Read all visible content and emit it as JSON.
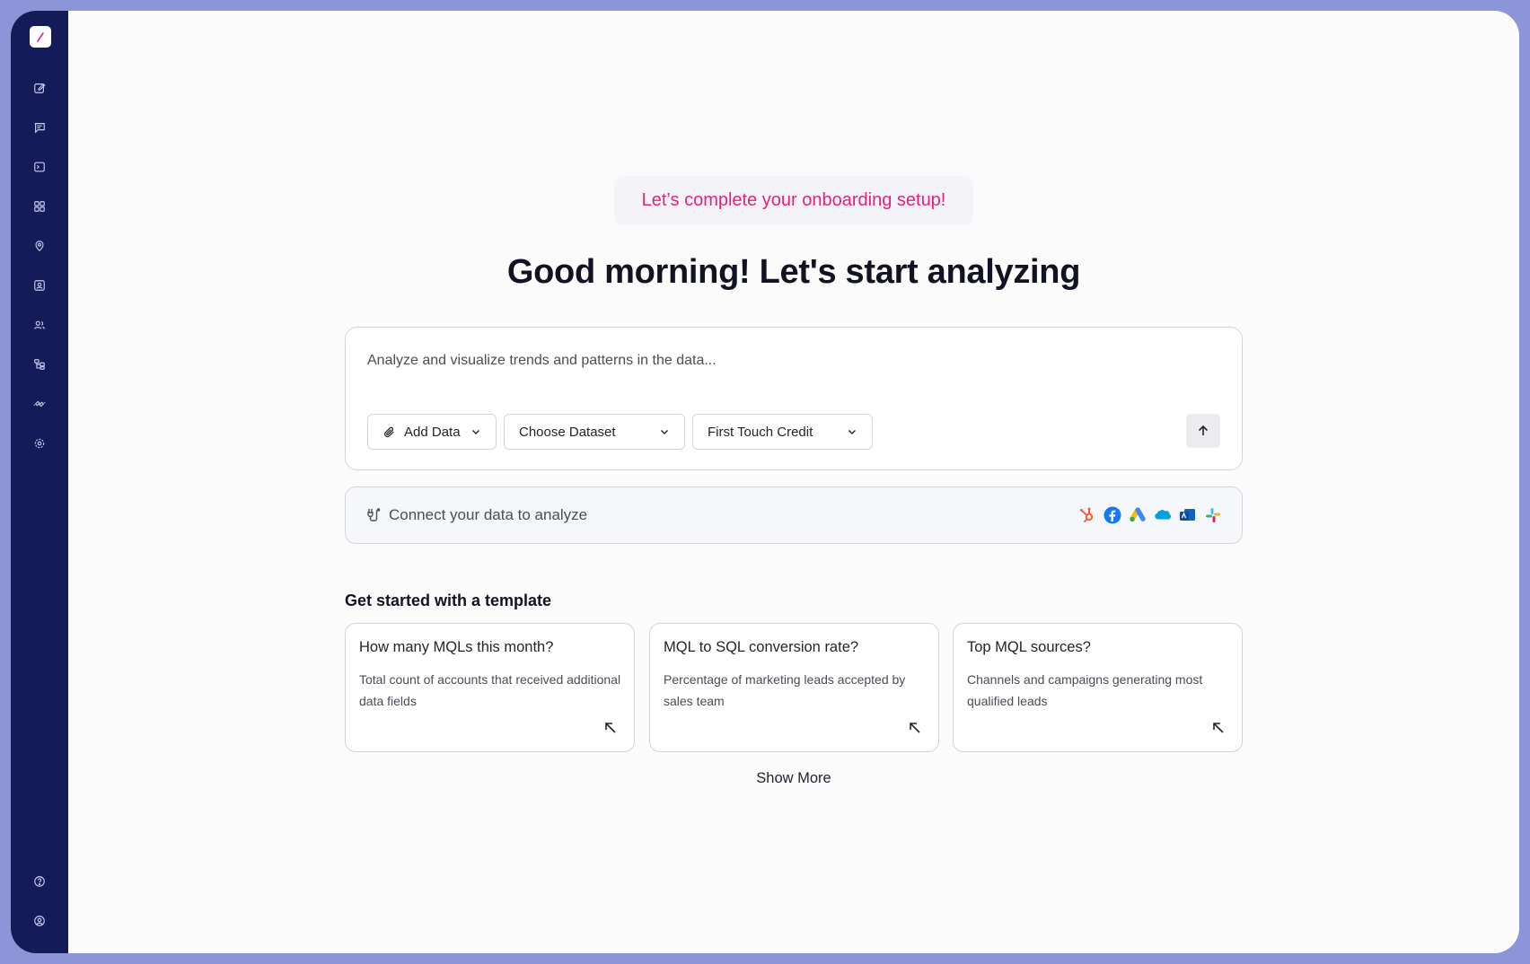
{
  "sidebar": {
    "nav_icons": [
      "edit-icon",
      "chat-icon",
      "terminal-icon",
      "grid-icon",
      "location-pin-icon",
      "contact-icon",
      "users-icon",
      "hierarchy-icon",
      "integrations-icon",
      "settings-icon"
    ],
    "bottom_icons": [
      "help-icon",
      "account-icon"
    ]
  },
  "onboarding": {
    "label": "Let’s complete your onboarding setup!"
  },
  "greeting": "Good morning! Let's start analyzing",
  "prompt": {
    "placeholder": "Analyze and visualize trends and patterns in the data...",
    "add_data": "Add Data",
    "dataset": "Choose Dataset",
    "attribution": "First Touch Credit"
  },
  "connect": {
    "label": "Connect your data to analyze",
    "integrations": [
      "hubspot-icon",
      "facebook-icon",
      "google-ads-icon",
      "salesforce-icon",
      "outreach-icon",
      "slack-icon"
    ]
  },
  "templates": {
    "title": "Get started with a template",
    "cards": [
      {
        "title": "How many MQLs this month?",
        "description": "Total count of accounts that received additional data fields"
      },
      {
        "title": "MQL to SQL conversion rate?",
        "description": "Percentage of marketing leads accepted by sales team"
      },
      {
        "title": "Top MQL sources?",
        "description": "Channels and campaigns generating most qualified leads"
      }
    ],
    "show_more": "Show More"
  },
  "colors": {
    "sidebar": "#141b59",
    "accent": "#e0237b",
    "frame": "#8c95d8"
  }
}
